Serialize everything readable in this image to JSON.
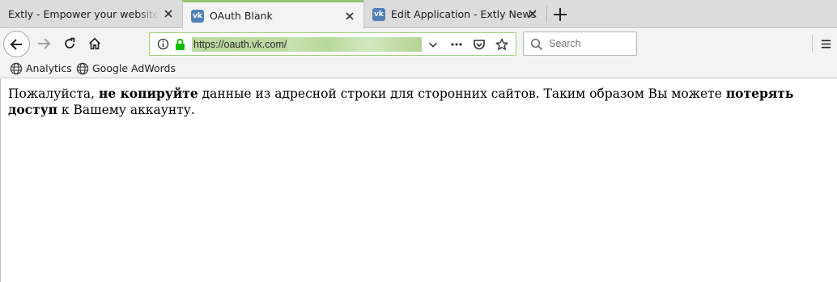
{
  "tabs": [
    {
      "title": "Extly - Empower your website with",
      "active": false
    },
    {
      "title": "OAuth Blank",
      "active": true,
      "favicon": "vk-icon"
    },
    {
      "title": "Edit Application - Extly News",
      "active": false,
      "favicon": "vk-icon"
    }
  ],
  "favicon_text": "vk",
  "url": "https://oauth.vk.com/",
  "search": {
    "placeholder": "Search"
  },
  "bookmarks": [
    "Analytics",
    "Google AdWords"
  ],
  "notice": {
    "part1": "Пожалуйста, ",
    "bold1": "не копируйте",
    "part2": " данные из адресной строки для сторонних сайтов. Таким образом Вы можете ",
    "bold2": "потерять доступ",
    "part3": " к Вашему аккаунту."
  },
  "colors": {
    "tab_accent": "#95c473",
    "urlbar_border": "#9fcf79",
    "lock_green": "#12bc00",
    "vk_blue": "#5181b8"
  }
}
